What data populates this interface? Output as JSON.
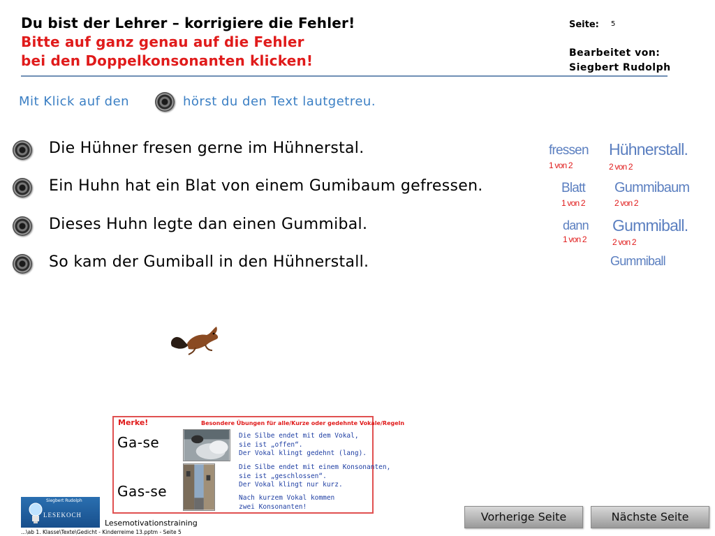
{
  "header": {
    "title": "Du bist der Lehrer – korrigiere die Fehler!",
    "instruction_line1": "Bitte auf ganz genau auf die Fehler",
    "instruction_line2": "bei den Doppelkonsonanten klicken!",
    "page_label": "Seite:",
    "page_number": "5",
    "edited_label": "Bearbeitet von:",
    "editor": "Siegbert Rudolph"
  },
  "hint": {
    "before": "Mit Klick auf den",
    "after": "hörst du den Text lautgetreu."
  },
  "sentences": [
    "Die Hühner fresen gerne im Hühnerstal.",
    "Ein Huhn hat ein Blat von einem Gumibaum gefressen.",
    "Dieses Huhn legte dan einen Gummibal.",
    "So kam der Gumiball in den Hühnerstall."
  ],
  "corrections": {
    "w1": {
      "word": "fressen",
      "count": "1 von 2"
    },
    "w2": {
      "word": "Hühnerstall.",
      "count": "2 von 2"
    },
    "w3": {
      "word": "Blatt",
      "count": "1 von 2"
    },
    "w4": {
      "word": "Gummibaum",
      "count": "2 von 2"
    },
    "w5": {
      "word": "dann",
      "count": "1 von 2"
    },
    "w6": {
      "word": "Gummiball.",
      "count": "2 von 2"
    },
    "w7": {
      "word": "Gummiball"
    }
  },
  "merke": {
    "title": "Merke!",
    "subtitle": "Besondere Übungen für alle/Kurze oder gedehnte Vokale/Regeln",
    "word1": "Ga-se",
    "word2": "Gas-se",
    "note1": [
      "Die Silbe endet mit dem Vokal,",
      "sie ist „offen“.",
      "Der Vokal klingt gedehnt (lang)."
    ],
    "note2": [
      "Die Silbe endet mit einem Konsonanten,",
      "sie ist „geschlossen“.",
      "Der Vokal klingt nur kurz."
    ],
    "note3": [
      "Nach kurzem Vokal kommen",
      "zwei Konsonanten!"
    ]
  },
  "footer": {
    "logo_name": "Siegbert Rudolph",
    "logo_word": "LESEKOCH",
    "title": "Lesemotivationstraining",
    "path": "...\\ab 1. Klasse\\Texte\\Gedicht - Kinderreime 13.pptm - Seite 5"
  },
  "nav": {
    "prev": "Vorherige Seite",
    "next": "Nächste Seite"
  },
  "icons": {
    "speaker": "speaker-icon",
    "squirrel": "squirrel-image",
    "lightbulb": "lightbulb-icon"
  }
}
